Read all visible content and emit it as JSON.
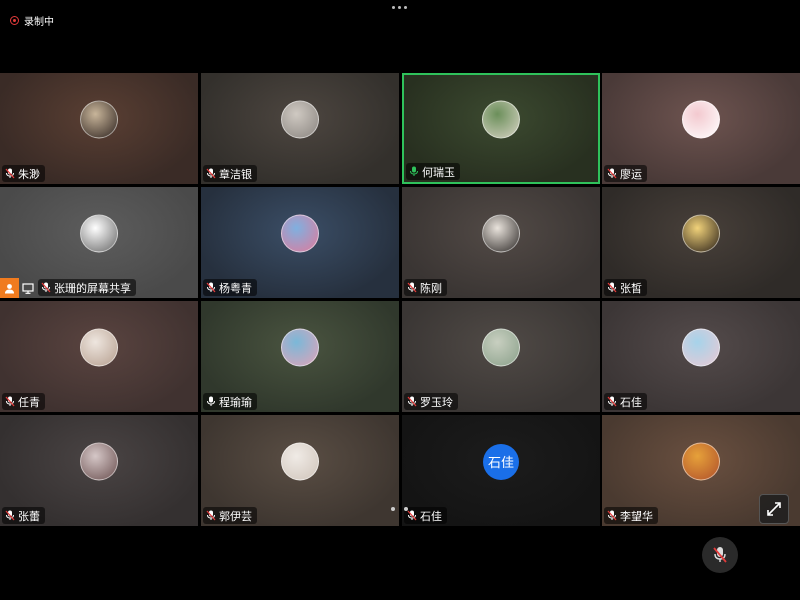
{
  "recording": {
    "label": "录制中"
  },
  "participants": [
    {
      "name": "朱渺",
      "mic": "muted",
      "bg": "#3a2b26",
      "bg2": "#5a3f33",
      "avatar": "photo",
      "avatar_colors": [
        "#c8b59a",
        "#2f2420"
      ]
    },
    {
      "name": "章洁银",
      "mic": "muted",
      "bg": "#33302c",
      "bg2": "#4d4640",
      "avatar": "photo",
      "avatar_colors": [
        "#cfc9c2",
        "#8a8580"
      ]
    },
    {
      "name": "何瑞玉",
      "mic": "active",
      "bg": "#283020",
      "bg2": "#3c4a30",
      "avatar": "photo",
      "avatar_colors": [
        "#6b8f5a",
        "#d7d3c4"
      ],
      "speaking": true
    },
    {
      "name": "廖运",
      "mic": "muted",
      "bg": "#4a3a38",
      "bg2": "#6e5450",
      "avatar": "photo",
      "avatar_colors": [
        "#f3c9cf",
        "#ffffff"
      ]
    },
    {
      "name": "张珊的屏幕共享",
      "mic": "muted",
      "bg": "#4a4a4a",
      "bg2": "#5d5d5d",
      "avatar": "photo",
      "avatar_colors": [
        "#ffffff",
        "#666666"
      ],
      "sharing": true
    },
    {
      "name": "杨粤青",
      "mic": "muted",
      "bg": "#26303e",
      "bg2": "#3b4e66",
      "avatar": "photo",
      "avatar_colors": [
        "#7fb0e0",
        "#e07a9b"
      ]
    },
    {
      "name": "陈刚",
      "mic": "muted",
      "bg": "#3a3533",
      "bg2": "#524a46",
      "avatar": "photo",
      "avatar_colors": [
        "#e9e3dc",
        "#2e2a28"
      ]
    },
    {
      "name": "张皙",
      "mic": "muted",
      "bg": "#2f2b28",
      "bg2": "#48403a",
      "avatar": "photo",
      "avatar_colors": [
        "#f1d27a",
        "#2a2018"
      ]
    },
    {
      "name": "任青",
      "mic": "muted",
      "bg": "#403230",
      "bg2": "#5a4440",
      "avatar": "photo",
      "avatar_colors": [
        "#eee6df",
        "#b69f8f"
      ]
    },
    {
      "name": "程瑜瑜",
      "mic": "active-white",
      "bg": "#30382c",
      "bg2": "#4a5440",
      "avatar": "photo",
      "avatar_colors": [
        "#7ab8d8",
        "#e0a3b8"
      ]
    },
    {
      "name": "罗玉玲",
      "mic": "muted",
      "bg": "#3a3634",
      "bg2": "#504a46",
      "avatar": "photo",
      "avatar_colors": [
        "#c8cfc0",
        "#8aa08a"
      ]
    },
    {
      "name": "石佳",
      "mic": "muted",
      "bg": "#3c3636",
      "bg2": "#544b4b",
      "avatar": "photo",
      "avatar_colors": [
        "#a6d3ea",
        "#e9c9d4"
      ]
    },
    {
      "name": "张蕾",
      "mic": "muted",
      "bg": "#343030",
      "bg2": "#4a4444",
      "avatar": "photo",
      "avatar_colors": [
        "#d5c7c7",
        "#6b5050"
      ]
    },
    {
      "name": "郭伊芸",
      "mic": "muted",
      "bg": "#3e3630",
      "bg2": "#5a4e44",
      "avatar": "photo",
      "avatar_colors": [
        "#f0ebe6",
        "#cfc4ba"
      ]
    },
    {
      "name": "石佳",
      "mic": "muted",
      "bg": "#141414",
      "bg2": "#1c1c1c",
      "avatar": "text",
      "avatar_text": "石佳",
      "avatar_colors": [
        "#1a6fe8",
        "#1a6fe8"
      ]
    },
    {
      "name": "李望华",
      "mic": "muted",
      "bg": "#4a3a30",
      "bg2": "#6a5040",
      "avatar": "photo",
      "avatar_colors": [
        "#e6a13a",
        "#b0502a"
      ]
    }
  ],
  "icons": {
    "more": "more-dots-icon",
    "mic_muted": "mic-muted-icon",
    "mic_active": "mic-icon",
    "share": "person-share-icon",
    "screen": "screen-share-icon",
    "exit_fullscreen": "exit-fullscreen-icon",
    "mute_toggle": "mic-muted-icon"
  },
  "colors": {
    "recording": "#e23b3b",
    "speaking_border": "#2fc25b",
    "mic_active": "#2fc25b",
    "share_badge": "#f07b1f",
    "text_avatar": "#1a6fe8"
  }
}
